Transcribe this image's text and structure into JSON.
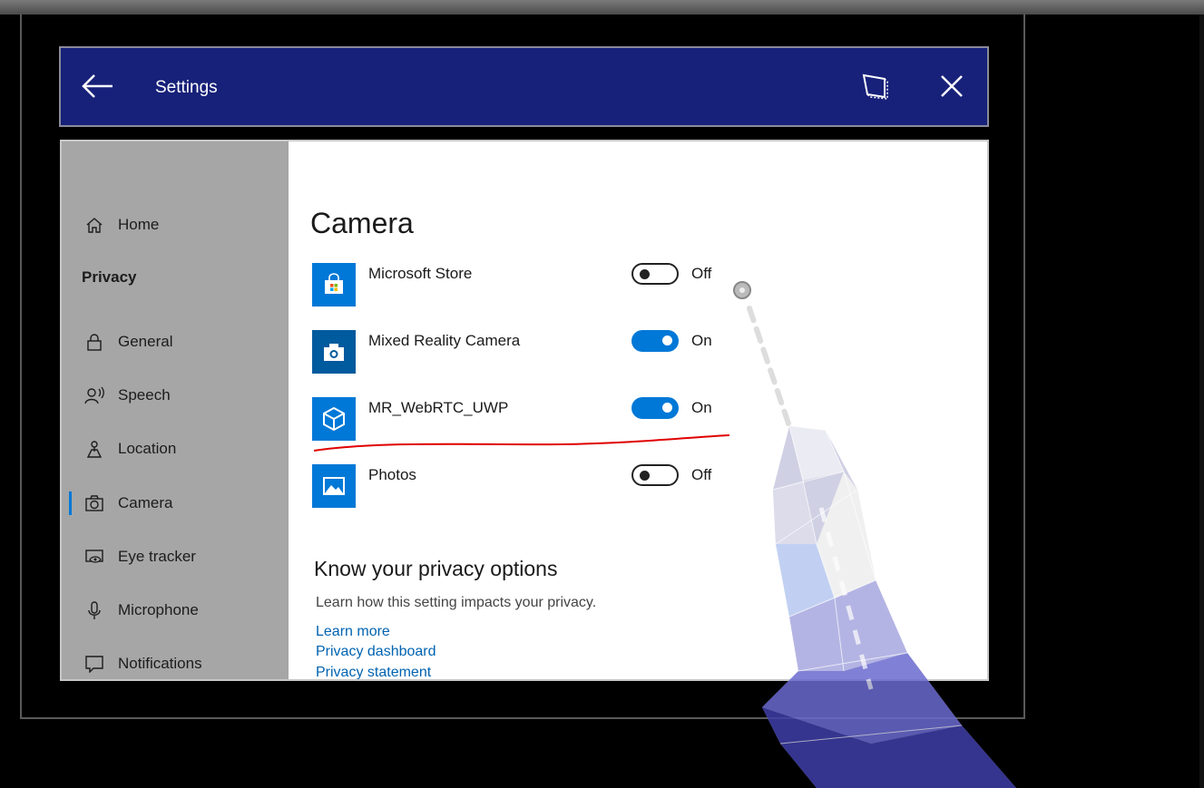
{
  "titlebar": {
    "title": "Settings",
    "back_icon": "arrow-left-icon",
    "snap_icon": "window-snap-icon",
    "close_icon": "close-icon",
    "background": "#172179"
  },
  "sidebar": {
    "home_label": "Home",
    "section_label": "Privacy",
    "items": [
      {
        "label": "General",
        "icon": "lock-icon"
      },
      {
        "label": "Speech",
        "icon": "speech-icon"
      },
      {
        "label": "Location",
        "icon": "location-icon"
      },
      {
        "label": "Camera",
        "icon": "camera-icon",
        "active": true
      },
      {
        "label": "Eye tracker",
        "icon": "eye-tracker-icon"
      },
      {
        "label": "Microphone",
        "icon": "microphone-icon"
      },
      {
        "label": "Notifications",
        "icon": "notifications-icon"
      }
    ]
  },
  "content": {
    "title": "Camera",
    "apps": [
      {
        "name": "Microsoft Store",
        "icon": "store-icon",
        "state": "Off"
      },
      {
        "name": "Mixed Reality Camera",
        "icon": "camera-app-icon",
        "state": "On"
      },
      {
        "name": "MR_WebRTC_UWP",
        "icon": "unity-icon",
        "state": "On"
      },
      {
        "name": "Photos",
        "icon": "photos-icon",
        "state": "Off"
      }
    ],
    "privacy": {
      "title": "Know your privacy options",
      "description": "Learn how this setting impacts your privacy.",
      "links": [
        "Learn more",
        "Privacy dashboard",
        "Privacy statement"
      ]
    }
  },
  "colors": {
    "accent": "#0078d7",
    "sidebar": "#a6a6a6",
    "annotation": "#e00000"
  }
}
